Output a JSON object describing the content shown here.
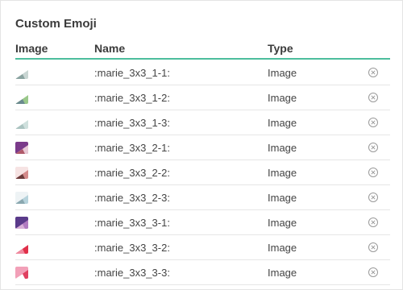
{
  "section": {
    "title": "Custom Emoji"
  },
  "table": {
    "columns": {
      "image": "Image",
      "name": "Name",
      "type": "Type"
    },
    "rows": [
      {
        "name": ":marie_3x3_1-1:",
        "type": "Image",
        "thumb_colors": [
          "#ffffff",
          "#c9d6d3",
          "#8aa3a0"
        ],
        "remove_icon": "remove-circle-icon"
      },
      {
        "name": ":marie_3x3_1-2:",
        "type": "Image",
        "thumb_colors": [
          "#ffffff",
          "#9ac88a",
          "#6b8a8f"
        ],
        "remove_icon": "remove-circle-icon"
      },
      {
        "name": ":marie_3x3_1-3:",
        "type": "Image",
        "thumb_colors": [
          "#ffffff",
          "#cfe0dd",
          "#aac3c0"
        ],
        "remove_icon": "remove-circle-icon"
      },
      {
        "name": ":marie_3x3_2-1:",
        "type": "Image",
        "thumb_colors": [
          "#7a3a8a",
          "#e8c9d6",
          "#b05a6a"
        ],
        "remove_icon": "remove-circle-icon"
      },
      {
        "name": ":marie_3x3_2-2:",
        "type": "Image",
        "thumb_colors": [
          "#f6e3e3",
          "#d48a8a",
          "#6a3a3a"
        ],
        "remove_icon": "remove-circle-icon"
      },
      {
        "name": ":marie_3x3_2-3:",
        "type": "Image",
        "thumb_colors": [
          "#eef3f5",
          "#b7d3dc",
          "#8aa8b0"
        ],
        "remove_icon": "remove-circle-icon"
      },
      {
        "name": ":marie_3x3_3-1:",
        "type": "Image",
        "thumb_colors": [
          "#5a3a8a",
          "#b07ac0",
          "#d8b0d8"
        ],
        "remove_icon": "remove-circle-icon"
      },
      {
        "name": ":marie_3x3_3-2:",
        "type": "Image",
        "thumb_colors": [
          "#ffffff",
          "#e0304a",
          "#f08aa0"
        ],
        "remove_icon": "remove-circle-icon"
      },
      {
        "name": ":marie_3x3_3-3:",
        "type": "Image",
        "thumb_colors": [
          "#f2a0b8",
          "#e04060",
          "#ffffff"
        ],
        "remove_icon": "remove-circle-icon"
      }
    ]
  },
  "colors": {
    "accent": "#4dbd9d",
    "divider": "#e6e6e6",
    "icon": "#9a9a9a"
  }
}
